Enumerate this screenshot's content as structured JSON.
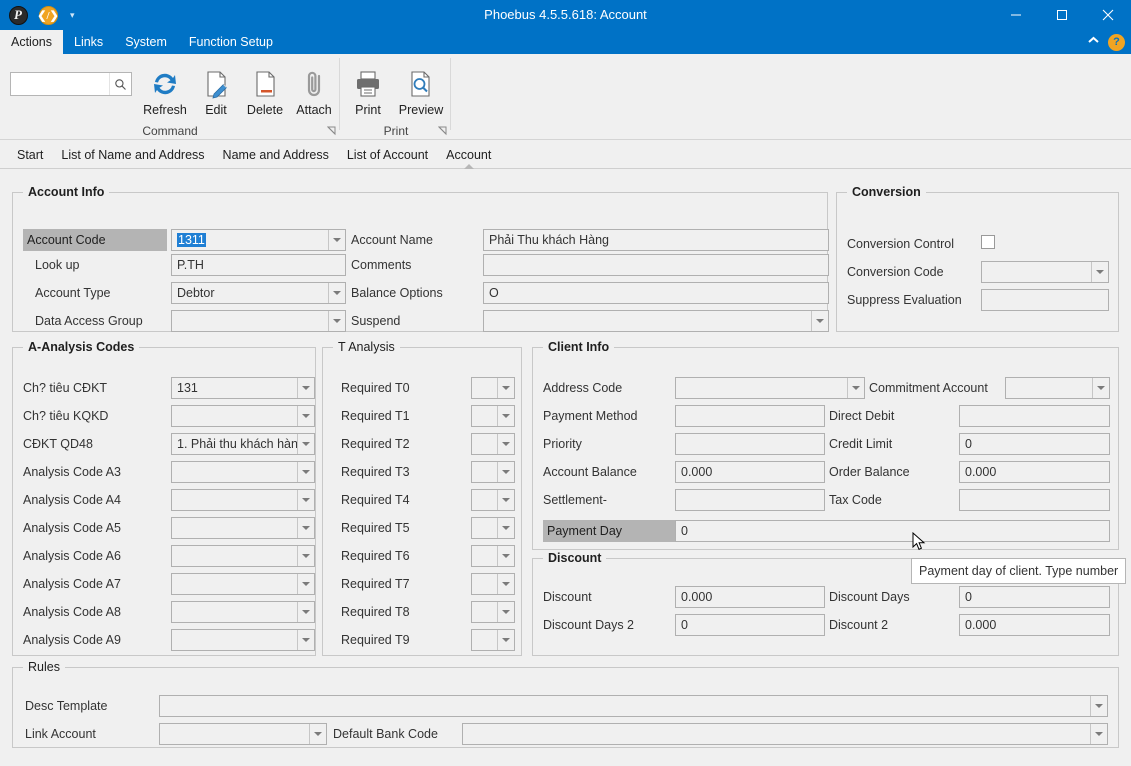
{
  "window": {
    "title": "Phoebus 4.5.5.618: Account",
    "quick_access": [
      {
        "name": "app-logo",
        "glyph": "P"
      },
      {
        "name": "code-icon",
        "glyph": "‹/›"
      }
    ],
    "controls": {
      "minimize": "minimize-icon",
      "maximize": "maximize-icon",
      "close": "close-icon"
    }
  },
  "ribbon": {
    "tabs": [
      {
        "label": "Actions",
        "active": true
      },
      {
        "label": "Links",
        "active": false
      },
      {
        "label": "System",
        "active": false
      },
      {
        "label": "Function Setup",
        "active": false
      }
    ],
    "collapse_label": "⌃",
    "help_label": "?",
    "search": {
      "value": "",
      "placeholder": ""
    },
    "groups": [
      {
        "label": "Command",
        "buttons": [
          "Refresh",
          "Edit",
          "Delete",
          "Attach"
        ]
      },
      {
        "label": "Print",
        "buttons": [
          "Print",
          "Preview"
        ]
      }
    ],
    "buttons": {
      "refresh": "Refresh",
      "edit": "Edit",
      "delete": "Delete",
      "attach": "Attach",
      "print": "Print",
      "preview": "Preview"
    },
    "group_labels": {
      "command": "Command",
      "print": "Print"
    }
  },
  "nav": {
    "items": [
      {
        "label": "Start",
        "active": false
      },
      {
        "label": "List of Name and Address",
        "active": false
      },
      {
        "label": "Name and Address",
        "active": false
      },
      {
        "label": "List of Account",
        "active": false
      },
      {
        "label": "Account",
        "active": true
      }
    ]
  },
  "account_info": {
    "legend": "Account Info",
    "account_code_label": "Account Code",
    "account_code_value": "1311",
    "lookup_label": "Look up",
    "lookup_value": "P.TH",
    "account_type_label": "Account Type",
    "account_type_value": "Debtor",
    "data_access_group_label": "Data Access Group",
    "data_access_group_value": "",
    "account_name_label": "Account Name",
    "account_name_value": "Phải Thu khách Hàng",
    "comments_label": "Comments",
    "comments_value": "",
    "balance_options_label": "Balance Options",
    "balance_options_value": "O",
    "suspend_label": "Suspend",
    "suspend_value": ""
  },
  "conversion": {
    "legend": "Conversion",
    "control_label": "Conversion Control",
    "control_checked": false,
    "code_label": "Conversion Code",
    "code_value": "",
    "suppress_label": "Suppress Evaluation",
    "suppress_value": ""
  },
  "analysis_codes": {
    "legend": "A-Analysis Codes",
    "rows": [
      {
        "label": "Ch? tiêu CĐKT",
        "value": "131"
      },
      {
        "label": "Ch? tiêu KQKD",
        "value": ""
      },
      {
        "label": "CĐKT QD48",
        "value": "1. Phải thu khách hàn"
      },
      {
        "label": "Analysis Code A3",
        "value": ""
      },
      {
        "label": "Analysis Code A4",
        "value": ""
      },
      {
        "label": "Analysis Code A5",
        "value": ""
      },
      {
        "label": "Analysis Code A6",
        "value": ""
      },
      {
        "label": "Analysis Code A7",
        "value": ""
      },
      {
        "label": "Analysis Code A8",
        "value": ""
      },
      {
        "label": "Analysis Code A9",
        "value": ""
      }
    ]
  },
  "t_analysis": {
    "legend": "T Analysis",
    "rows": [
      {
        "label": "Required T0",
        "value": ""
      },
      {
        "label": "Required T1",
        "value": ""
      },
      {
        "label": "Required T2",
        "value": ""
      },
      {
        "label": "Required T3",
        "value": ""
      },
      {
        "label": "Required T4",
        "value": ""
      },
      {
        "label": "Required T5",
        "value": ""
      },
      {
        "label": "Required T6",
        "value": ""
      },
      {
        "label": "Required T7",
        "value": ""
      },
      {
        "label": "Required T8",
        "value": ""
      },
      {
        "label": "Required T9",
        "value": ""
      }
    ]
  },
  "client_info": {
    "legend": "Client Info",
    "address_code_label": "Address Code",
    "address_code_value": "",
    "commitment_account_label": "Commitment Account",
    "commitment_account_value": "",
    "payment_method_label": "Payment Method",
    "payment_method_value": "",
    "direct_debit_label": "Direct Debit",
    "direct_debit_value": "",
    "priority_label": "Priority",
    "priority_value": "",
    "credit_limit_label": "Credit Limit",
    "credit_limit_value": "0",
    "account_balance_label": "Account Balance",
    "account_balance_value": "0.000",
    "order_balance_label": "Order Balance",
    "order_balance_value": "0.000",
    "settlement_label": "Settlement-",
    "settlement_value": "",
    "tax_code_label": "Tax Code",
    "tax_code_value": "",
    "payment_day_label": "Payment Day",
    "payment_day_value": "0"
  },
  "discount": {
    "legend": "Discount",
    "discount_label": "Discount",
    "discount_value": "0.000",
    "discount_days_label": "Discount Days",
    "discount_days_value": "0",
    "discount_days2_label": "Discount Days 2",
    "discount_days2_value": "0",
    "discount2_label": "Discount 2",
    "discount2_value": "0.000"
  },
  "rules": {
    "legend": "Rules",
    "desc_template_label": "Desc Template",
    "desc_template_value": "",
    "link_account_label": "Link Account",
    "link_account_value": "",
    "default_bank_code_label": "Default Bank Code",
    "default_bank_code_value": ""
  },
  "tooltip": {
    "text": "Payment day of client. Type number"
  },
  "colors": {
    "titlebar": "#0072c6",
    "accent": "#0072c6",
    "selection": "#1f7fd4",
    "highlight_label": "#b4b4b4",
    "surface": "#f0f0f0"
  }
}
